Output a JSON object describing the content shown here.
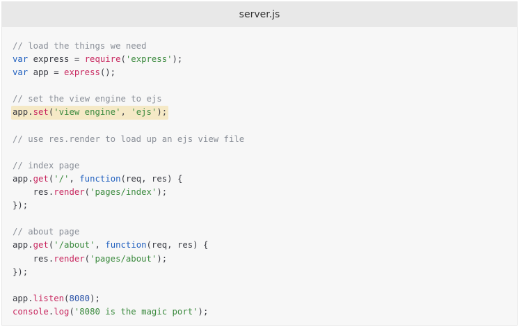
{
  "window": {
    "title": "server.js"
  },
  "colors": {
    "comment": "#8a8f98",
    "keyword": "#1f5fbf",
    "function": "#c8275f",
    "string": "#3b8a3e",
    "number": "#2b53a8",
    "highlight": "#f5e9c6"
  },
  "code": {
    "lines": [
      {
        "highlight": false,
        "tokens": [
          {
            "t": "comment",
            "v": "// load the things we need"
          }
        ]
      },
      {
        "highlight": false,
        "tokens": [
          {
            "t": "keyword",
            "v": "var"
          },
          {
            "t": "plain",
            "v": " express = "
          },
          {
            "t": "func",
            "v": "require"
          },
          {
            "t": "plain",
            "v": "("
          },
          {
            "t": "string",
            "v": "'express'"
          },
          {
            "t": "plain",
            "v": ");"
          }
        ]
      },
      {
        "highlight": false,
        "tokens": [
          {
            "t": "keyword",
            "v": "var"
          },
          {
            "t": "plain",
            "v": " app = "
          },
          {
            "t": "func",
            "v": "express"
          },
          {
            "t": "plain",
            "v": "();"
          }
        ]
      },
      {
        "highlight": false,
        "tokens": []
      },
      {
        "highlight": false,
        "tokens": [
          {
            "t": "comment",
            "v": "// set the view engine to ejs"
          }
        ]
      },
      {
        "highlight": true,
        "tokens": [
          {
            "t": "plain",
            "v": "app."
          },
          {
            "t": "func",
            "v": "set"
          },
          {
            "t": "plain",
            "v": "("
          },
          {
            "t": "string",
            "v": "'view engine'"
          },
          {
            "t": "plain",
            "v": ", "
          },
          {
            "t": "string",
            "v": "'ejs'"
          },
          {
            "t": "plain",
            "v": ");"
          }
        ]
      },
      {
        "highlight": false,
        "tokens": []
      },
      {
        "highlight": false,
        "tokens": [
          {
            "t": "comment",
            "v": "// use res.render to load up an ejs view file"
          }
        ]
      },
      {
        "highlight": false,
        "tokens": []
      },
      {
        "highlight": false,
        "tokens": [
          {
            "t": "comment",
            "v": "// index page"
          }
        ]
      },
      {
        "highlight": false,
        "tokens": [
          {
            "t": "plain",
            "v": "app."
          },
          {
            "t": "func",
            "v": "get"
          },
          {
            "t": "plain",
            "v": "("
          },
          {
            "t": "string",
            "v": "'/'"
          },
          {
            "t": "plain",
            "v": ", "
          },
          {
            "t": "keyword",
            "v": "function"
          },
          {
            "t": "plain",
            "v": "(req, res) {"
          }
        ]
      },
      {
        "highlight": false,
        "tokens": [
          {
            "t": "plain",
            "v": "    res."
          },
          {
            "t": "func",
            "v": "render"
          },
          {
            "t": "plain",
            "v": "("
          },
          {
            "t": "string",
            "v": "'pages/index'"
          },
          {
            "t": "plain",
            "v": ");"
          }
        ]
      },
      {
        "highlight": false,
        "tokens": [
          {
            "t": "plain",
            "v": "});"
          }
        ]
      },
      {
        "highlight": false,
        "tokens": []
      },
      {
        "highlight": false,
        "tokens": [
          {
            "t": "comment",
            "v": "// about page"
          }
        ]
      },
      {
        "highlight": false,
        "tokens": [
          {
            "t": "plain",
            "v": "app."
          },
          {
            "t": "func",
            "v": "get"
          },
          {
            "t": "plain",
            "v": "("
          },
          {
            "t": "string",
            "v": "'/about'"
          },
          {
            "t": "plain",
            "v": ", "
          },
          {
            "t": "keyword",
            "v": "function"
          },
          {
            "t": "plain",
            "v": "(req, res) {"
          }
        ]
      },
      {
        "highlight": false,
        "tokens": [
          {
            "t": "plain",
            "v": "    res."
          },
          {
            "t": "func",
            "v": "render"
          },
          {
            "t": "plain",
            "v": "("
          },
          {
            "t": "string",
            "v": "'pages/about'"
          },
          {
            "t": "plain",
            "v": ");"
          }
        ]
      },
      {
        "highlight": false,
        "tokens": [
          {
            "t": "plain",
            "v": "});"
          }
        ]
      },
      {
        "highlight": false,
        "tokens": []
      },
      {
        "highlight": false,
        "tokens": [
          {
            "t": "plain",
            "v": "app."
          },
          {
            "t": "func",
            "v": "listen"
          },
          {
            "t": "plain",
            "v": "("
          },
          {
            "t": "number",
            "v": "8080"
          },
          {
            "t": "plain",
            "v": ");"
          }
        ]
      },
      {
        "highlight": false,
        "tokens": [
          {
            "t": "func",
            "v": "console"
          },
          {
            "t": "plain",
            "v": "."
          },
          {
            "t": "func",
            "v": "log"
          },
          {
            "t": "plain",
            "v": "("
          },
          {
            "t": "string",
            "v": "'8080 is the magic port'"
          },
          {
            "t": "plain",
            "v": ");"
          }
        ]
      }
    ]
  }
}
